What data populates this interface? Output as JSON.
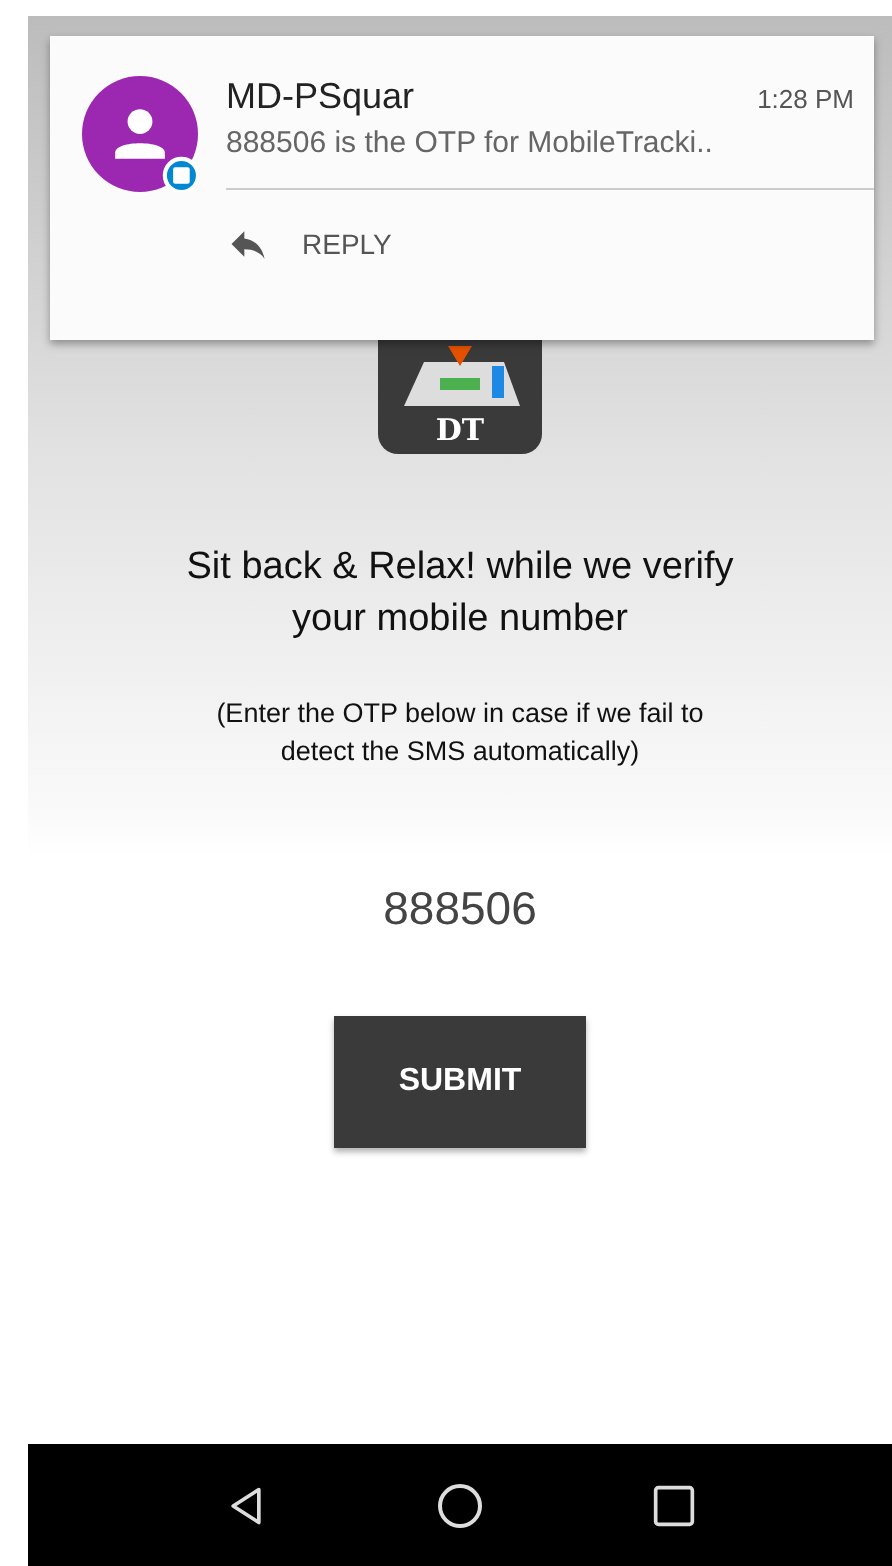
{
  "notification": {
    "sender": "MD-PSquar",
    "time": "1:28 PM",
    "message": "888506 is the OTP for MobileTracki..",
    "action": "REPLY"
  },
  "app": {
    "logo_text": "DT",
    "heading": "Sit back & Relax! while we verify your mobile number",
    "hint": "(Enter the OTP below in case if we fail to detect the SMS automatically)",
    "otp": "888506",
    "submit": "SUBMIT"
  },
  "nav_bar": [
    {
      "kind": "back"
    },
    {
      "kind": "home"
    },
    {
      "kind": "recents"
    }
  ]
}
